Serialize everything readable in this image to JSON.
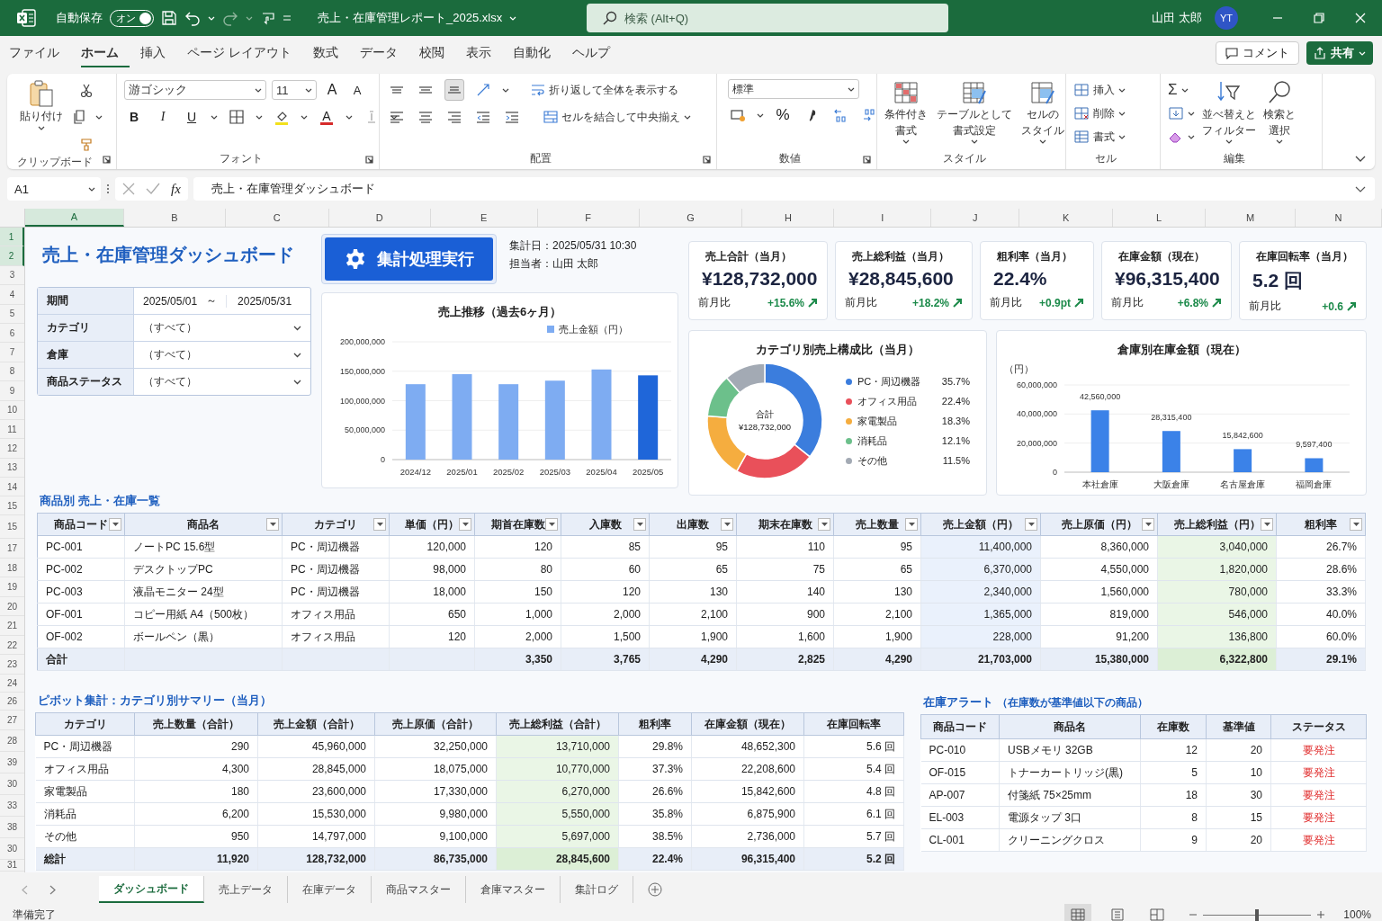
{
  "title_bar": {
    "autosave": "自動保存",
    "autosave_toggle": {
      "label": "オン",
      "on": true
    },
    "file_name": "売上・在庫管理レポート_2025.xlsx",
    "search": {
      "placeholder": "検索 (Alt+Q)"
    },
    "user_name": "山田 太郎",
    "avatar": "YT"
  },
  "menu": {
    "tabs": [
      {
        "label": "ファイル",
        "selected": false
      },
      {
        "label": "ホーム",
        "selected": true
      },
      {
        "label": "挿入",
        "selected": false
      },
      {
        "label": "ページ レイアウト",
        "selected": false
      },
      {
        "label": "数式",
        "selected": false
      },
      {
        "label": "データ",
        "selected": false
      },
      {
        "label": "校閲",
        "selected": false
      },
      {
        "label": "表示",
        "selected": false
      },
      {
        "label": "自動化",
        "selected": false
      },
      {
        "label": "ヘルプ",
        "selected": false
      }
    ],
    "comment_button": "コメント",
    "share_button": "共有"
  },
  "ribbon": {
    "groups": [
      {
        "kind": "clipboard",
        "label": "クリップボード",
        "paste": "貼り付け"
      },
      {
        "kind": "font",
        "label": "フォント",
        "font": "游ゴシック",
        "size": "11",
        "grow": "A",
        "shrink": "A",
        "bold": "B",
        "italic": "I",
        "underline": "U",
        "font_color": "A"
      },
      {
        "kind": "alignment",
        "label": "配置",
        "wrap": "折り返して全体を表示する",
        "merge": "セルを結合して中央揃え"
      },
      {
        "kind": "number",
        "label": "数値",
        "format": "標準",
        "percent": "%"
      },
      {
        "kind": "styles",
        "label": "スタイル",
        "buttons": [
          {
            "lines": [
              "条件付き",
              "書式"
            ]
          },
          {
            "lines": [
              "テーブルとして",
              "書式設定"
            ]
          },
          {
            "lines": [
              "セルの",
              "スタイル"
            ]
          }
        ]
      },
      {
        "kind": "cells",
        "label": "セル",
        "buttons": [
          "挿入",
          "削除",
          "書式"
        ]
      },
      {
        "kind": "editing",
        "label": "編集",
        "autosum": "Σ",
        "buttons": [
          {
            "lines": [
              "並べ替えと",
              "フィルター"
            ]
          },
          {
            "lines": [
              "検索と",
              "選択"
            ]
          }
        ]
      }
    ]
  },
  "formula_bar": {
    "name_box": "A1",
    "fx": "fx",
    "formula": "売上・在庫管理ダッシュボード"
  },
  "column_headers": [
    {
      "label": "A",
      "selected": true
    },
    {
      "label": "B",
      "selected": false
    },
    {
      "label": "C",
      "selected": false
    },
    {
      "label": "D",
      "selected": false
    },
    {
      "label": "E",
      "selected": false
    },
    {
      "label": "F",
      "selected": false
    },
    {
      "label": "G",
      "selected": false
    },
    {
      "label": "H",
      "selected": false
    },
    {
      "label": "I",
      "selected": false
    },
    {
      "label": "J",
      "selected": false
    },
    {
      "label": "K",
      "selected": false
    },
    {
      "label": "L",
      "selected": false
    },
    {
      "label": "M",
      "selected": false
    },
    {
      "label": "N",
      "selected": false
    }
  ],
  "row_numbers": [
    {
      "label": "1",
      "selected": true
    },
    {
      "label": "2",
      "selected": true
    },
    {
      "label": "3",
      "selected": false
    },
    {
      "label": "4",
      "selected": false
    },
    {
      "label": "5",
      "selected": false
    },
    {
      "label": "6",
      "selected": false
    },
    {
      "label": "7",
      "selected": false
    },
    {
      "label": "8",
      "selected": false
    },
    {
      "label": "9",
      "selected": false
    },
    {
      "label": "10",
      "selected": false
    },
    {
      "label": "11",
      "selected": false
    },
    {
      "label": "12",
      "selected": false
    },
    {
      "label": "13",
      "selected": false
    },
    {
      "label": "14",
      "selected": false
    },
    {
      "label": "15",
      "selected": false
    },
    {
      "label": "15",
      "selected": false
    },
    {
      "label": "17",
      "selected": false
    },
    {
      "label": "18",
      "selected": false
    },
    {
      "label": "19",
      "selected": false
    },
    {
      "label": "20",
      "selected": false
    },
    {
      "label": "21",
      "selected": false
    },
    {
      "label": "22",
      "selected": false
    },
    {
      "label": "23",
      "selected": false
    },
    {
      "label": "24",
      "selected": false
    },
    {
      "label": "26",
      "selected": false
    },
    {
      "label": "27",
      "selected": false
    },
    {
      "label": "28",
      "selected": false
    },
    {
      "label": "39",
      "selected": false
    },
    {
      "label": "30",
      "selected": false
    },
    {
      "label": "33",
      "selected": false
    },
    {
      "label": "38",
      "selected": false
    },
    {
      "label": "30",
      "selected": false
    },
    {
      "label": "31",
      "selected": false
    }
  ],
  "dashboard": {
    "title": "売上・在庫管理ダッシュボード",
    "filters": [
      {
        "kind": "range",
        "label": "期間",
        "from": "2025/05/01",
        "separator": "～",
        "to": "2025/05/31"
      },
      {
        "kind": "dropdown",
        "label": "カテゴリ",
        "value": "（すべて）"
      },
      {
        "kind": "dropdown",
        "label": "倉庫",
        "value": "（すべて）"
      },
      {
        "kind": "dropdown",
        "label": "商品ステータス",
        "value": "（すべて）"
      }
    ],
    "run_button": "集計処理実行",
    "meta": [
      "集計日：2025/05/31 10:30",
      "担当者：山田 太郎"
    ],
    "kpis": [
      {
        "label": "売上合計（当月）",
        "value": "¥128,732,000",
        "compare": "前月比",
        "delta": "+15.6%",
        "trend_up": true
      },
      {
        "label": "売上総利益（当月）",
        "value": "¥28,845,600",
        "compare": "前月比",
        "delta": "+18.2%",
        "trend_up": true
      },
      {
        "label": "粗利率（当月）",
        "value": "22.4%",
        "compare": "前月比",
        "delta": "+0.9pt",
        "trend_up": true
      },
      {
        "label": "在庫金額（現在）",
        "value": "¥96,315,400",
        "compare": "前月比",
        "delta": "+6.8%",
        "trend_up": true
      },
      {
        "label": "在庫回転率（当月）",
        "value": "5.2 回",
        "compare": "前月比",
        "delta": "+0.6",
        "trend_up": true
      }
    ],
    "sales_chart": {
      "chart_data": {
        "type": "bar",
        "title": "売上推移（過去6ヶ月）",
        "categories": [
          "2024/12",
          "2025/01",
          "2025/02",
          "2025/03",
          "2025/04",
          "2025/05"
        ],
        "series": [
          {
            "name": "売上金額（円）",
            "colors": [
              "#7eacf2",
              "#7eacf2",
              "#7eacf2",
              "#7eacf2",
              "#7eacf2",
              "#1f66d9"
            ],
            "values": [
              128000000,
              145000000,
              128000000,
              134000000,
              153000000,
              143000000
            ]
          }
        ],
        "grid": true,
        "legend": "top-right",
        "ylim": [
          0,
          200000000
        ],
        "yticks": [
          {
            "value": 0,
            "label": "0"
          },
          {
            "value": 50000000,
            "label": "50,000,000"
          },
          {
            "value": 100000000,
            "label": "100,000,000"
          },
          {
            "value": 150000000,
            "label": "150,000,000"
          },
          {
            "value": 200000000,
            "label": "200,000,000"
          }
        ]
      }
    },
    "category_chart": {
      "center_label": "合計",
      "center_value": "¥128,732,000",
      "chart_data": {
        "type": "donut",
        "title": "カテゴリ別売上構成比（当月）",
        "categories": [
          "PC・周辺機器",
          "オフィス用品",
          "家電製品",
          "消耗品",
          "その他"
        ],
        "legend": "right",
        "series": [
          {
            "colors": [
              "#3b7ddd",
              "#e9505a",
              "#f5ad3f",
              "#6cc08b",
              "#a3aab4"
            ],
            "values": [
              35.7,
              22.4,
              18.3,
              12.1,
              11.5
            ]
          }
        ],
        "value_labels": [
          "35.7%",
          "22.4%",
          "18.3%",
          "12.1%",
          "11.5%"
        ]
      }
    },
    "warehouse_chart": {
      "chart_data": {
        "type": "bar",
        "title": "倉庫別在庫金額（現在）",
        "ylabel": "（円）",
        "categories": [
          "本社倉庫",
          "大阪倉庫",
          "名古屋倉庫",
          "福岡倉庫"
        ],
        "grid": true,
        "series": [
          {
            "color": "#3b82e8",
            "values": [
              42560000,
              28315400,
              15842600,
              9597400
            ]
          }
        ],
        "ylim": [
          0,
          60000000
        ],
        "yticks": [
          {
            "value": 0,
            "label": "0"
          },
          {
            "value": 20000000,
            "label": "20,000,000"
          },
          {
            "value": 40000000,
            "label": "40,000,000"
          },
          {
            "value": 60000000,
            "label": "60,000,000"
          }
        ],
        "value_labels": [
          "42,560,000",
          "28,315,400",
          "15,842,600",
          "9,597,400"
        ]
      }
    }
  },
  "product_table": {
    "title": "商品別 売上・在庫一覧",
    "columns": [
      {
        "label": "商品コード",
        "kind": "text"
      },
      {
        "label": "商品名",
        "kind": "text"
      },
      {
        "label": "カテゴリ",
        "kind": "text"
      },
      {
        "label": "単価（円）",
        "kind": "number"
      },
      {
        "label": "期首在庫数",
        "kind": "number"
      },
      {
        "label": "入庫数",
        "kind": "number"
      },
      {
        "label": "出庫数",
        "kind": "number"
      },
      {
        "label": "期末在庫数",
        "kind": "number"
      },
      {
        "label": "売上数量",
        "kind": "number"
      },
      {
        "label": "売上金額（円）",
        "kind": "sales"
      },
      {
        "label": "売上原価（円）",
        "kind": "number"
      },
      {
        "label": "売上総利益（円）",
        "kind": "profit"
      },
      {
        "label": "粗利率",
        "kind": "number"
      }
    ],
    "rows": [
      [
        "PC-001",
        "ノートPC 15.6型",
        "PC・周辺機器",
        "120,000",
        "120",
        "85",
        "95",
        "110",
        "95",
        "11,400,000",
        "8,360,000",
        "3,040,000",
        "26.7%"
      ],
      [
        "PC-002",
        "デスクトップPC",
        "PC・周辺機器",
        "98,000",
        "80",
        "60",
        "65",
        "75",
        "65",
        "6,370,000",
        "4,550,000",
        "1,820,000",
        "28.6%"
      ],
      [
        "PC-003",
        "液晶モニター 24型",
        "PC・周辺機器",
        "18,000",
        "150",
        "120",
        "130",
        "140",
        "130",
        "2,340,000",
        "1,560,000",
        "780,000",
        "33.3%"
      ],
      [
        "OF-001",
        "コピー用紙 A4（500枚）",
        "オフィス用品",
        "650",
        "1,000",
        "2,000",
        "2,100",
        "900",
        "2,100",
        "1,365,000",
        "819,000",
        "546,000",
        "40.0%"
      ],
      [
        "OF-002",
        "ボールペン（黒）",
        "オフィス用品",
        "120",
        "2,000",
        "1,500",
        "1,900",
        "1,600",
        "1,900",
        "228,000",
        "91,200",
        "136,800",
        "60.0%"
      ]
    ],
    "total": {
      "label": "合計",
      "cells": [
        "3,350",
        "3,765",
        "4,290",
        "2,825",
        "4,290",
        "21,703,000",
        "15,380,000",
        "6,322,800",
        "29.1%"
      ]
    }
  },
  "pivot_table": {
    "title": "ピボット集計：カテゴリ別サマリー（当月）",
    "columns": [
      {
        "label": "カテゴリ",
        "kind": "text"
      },
      {
        "label": "売上数量（合計）",
        "kind": "number"
      },
      {
        "label": "売上金額（合計）",
        "kind": "number"
      },
      {
        "label": "売上原価（合計）",
        "kind": "number"
      },
      {
        "label": "売上総利益（合計）",
        "kind": "profit"
      },
      {
        "label": "粗利率",
        "kind": "number"
      },
      {
        "label": "在庫金額（現在）",
        "kind": "number"
      },
      {
        "label": "在庫回転率",
        "kind": "number"
      }
    ],
    "rows": [
      [
        "PC・周辺機器",
        "290",
        "45,960,000",
        "32,250,000",
        "13,710,000",
        "29.8%",
        "48,652,300",
        "5.6 回"
      ],
      [
        "オフィス用品",
        "4,300",
        "28,845,000",
        "18,075,000",
        "10,770,000",
        "37.3%",
        "22,208,600",
        "5.4 回"
      ],
      [
        "家電製品",
        "180",
        "23,600,000",
        "17,330,000",
        "6,270,000",
        "26.6%",
        "15,842,600",
        "4.8 回"
      ],
      [
        "消耗品",
        "6,200",
        "15,530,000",
        "9,980,000",
        "5,550,000",
        "35.8%",
        "6,875,900",
        "6.1 回"
      ],
      [
        "その他",
        "950",
        "14,797,000",
        "9,100,000",
        "5,697,000",
        "38.5%",
        "2,736,000",
        "5.7 回"
      ]
    ],
    "total": {
      "label": "総計",
      "cells": [
        "11,920",
        "128,732,000",
        "86,735,000",
        "28,845,600",
        "22.4%",
        "96,315,400",
        "5.2 回"
      ]
    }
  },
  "stock_alert": {
    "title": "在庫アラート",
    "subtitle": "（在庫数が基準値以下の商品）",
    "columns": [
      {
        "label": "商品コード",
        "kind": "text"
      },
      {
        "label": "商品名",
        "kind": "text"
      },
      {
        "label": "在庫数",
        "kind": "number"
      },
      {
        "label": "基準値",
        "kind": "number"
      },
      {
        "label": "ステータス",
        "kind": "status"
      }
    ],
    "rows": [
      [
        "PC-010",
        "USBメモリ 32GB",
        "12",
        "20",
        "要発注"
      ],
      [
        "OF-015",
        "トナーカートリッジ(黒)",
        "5",
        "10",
        "要発注"
      ],
      [
        "AP-007",
        "付箋紙 75×25mm",
        "18",
        "30",
        "要発注"
      ],
      [
        "EL-003",
        "電源タップ 3口",
        "8",
        "15",
        "要発注"
      ],
      [
        "CL-001",
        "クリーニングクロス",
        "9",
        "20",
        "要発注"
      ]
    ]
  },
  "sheet_tabs": [
    {
      "label": "ダッシュボード",
      "selected": true
    },
    {
      "label": "売上データ",
      "selected": false
    },
    {
      "label": "在庫データ",
      "selected": false
    },
    {
      "label": "商品マスター",
      "selected": false
    },
    {
      "label": "倉庫マスター",
      "selected": false
    },
    {
      "label": "集計ログ",
      "selected": false
    }
  ],
  "status_bar": {
    "status": "準備完了",
    "views": [
      {
        "kind": "normal",
        "selected": true
      },
      {
        "kind": "page_layout",
        "selected": false
      },
      {
        "kind": "page_break",
        "selected": false
      }
    ],
    "zoom": {
      "level": 0.5,
      "label": "100%"
    }
  }
}
